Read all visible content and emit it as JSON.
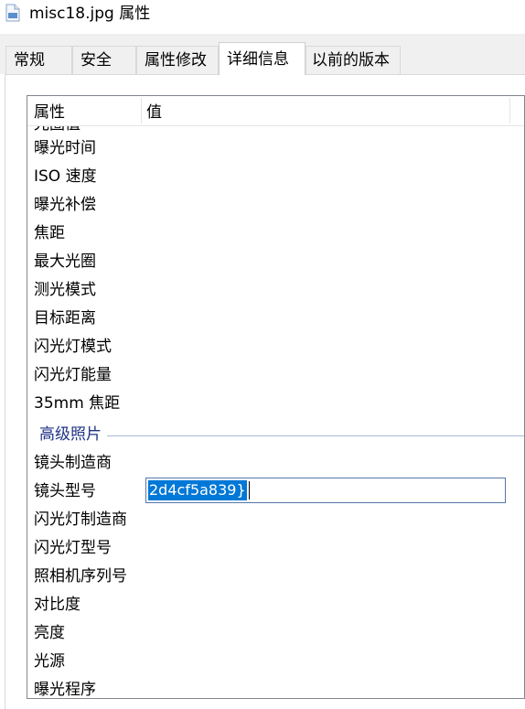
{
  "window": {
    "title": "misc18.jpg 属性",
    "icon": "jpg-file-icon"
  },
  "tabs": [
    {
      "label": "常规",
      "active": false
    },
    {
      "label": "安全",
      "active": false
    },
    {
      "label": "属性修改",
      "active": false
    },
    {
      "label": "详细信息",
      "active": true
    },
    {
      "label": "以前的版本",
      "active": false
    }
  ],
  "details": {
    "columns": {
      "property": "属性",
      "value": "值"
    },
    "cut_row": "光圈值",
    "rows_top": [
      "曝光时间",
      "ISO 速度",
      "曝光补偿",
      "焦距",
      "最大光圈",
      "测光模式",
      "目标距离",
      "闪光灯模式",
      "闪光灯能量",
      "35mm 焦距"
    ],
    "group": "高级照片",
    "lens_maker": "镜头制造商",
    "lens_model": {
      "label": "镜头型号",
      "edit_value": "2d4cf5a839}"
    },
    "rows_bottom": [
      "闪光灯制造商",
      "闪光灯型号",
      "照相机序列号",
      "对比度",
      "亮度",
      "光源",
      "曝光程序"
    ]
  },
  "colors": {
    "accent": "#0078d7",
    "group_text": "#1e3287",
    "tab_bg": "#f0f0f0"
  }
}
